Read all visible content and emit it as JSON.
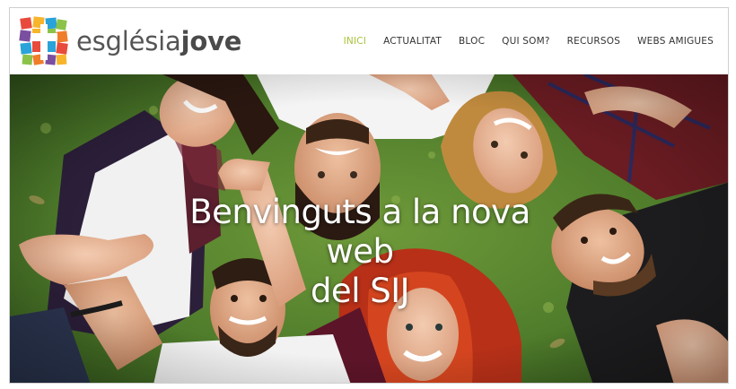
{
  "brand": {
    "name_light": "església",
    "name_bold": "jove",
    "logo_icon": "cross-mosaic-icon",
    "colors": [
      "#e84a3c",
      "#f7b52c",
      "#8bc34a",
      "#29a3d9",
      "#7b4fa0",
      "#f07d2a"
    ]
  },
  "nav": {
    "items": [
      {
        "label": "INICI",
        "active": true
      },
      {
        "label": "ACTUALITAT",
        "active": false
      },
      {
        "label": "BLOC",
        "active": false
      },
      {
        "label": "QUI SOM?",
        "active": false
      },
      {
        "label": "RECURSOS",
        "active": false
      },
      {
        "label": "WEBS AMIGUES",
        "active": false
      }
    ],
    "active_color": "#a8c33a"
  },
  "hero": {
    "title_line1": "Benvinguts a la nova web",
    "title_line2": "del SIJ",
    "image": "group-of-young-people-lying-in-circle-on-grass"
  }
}
